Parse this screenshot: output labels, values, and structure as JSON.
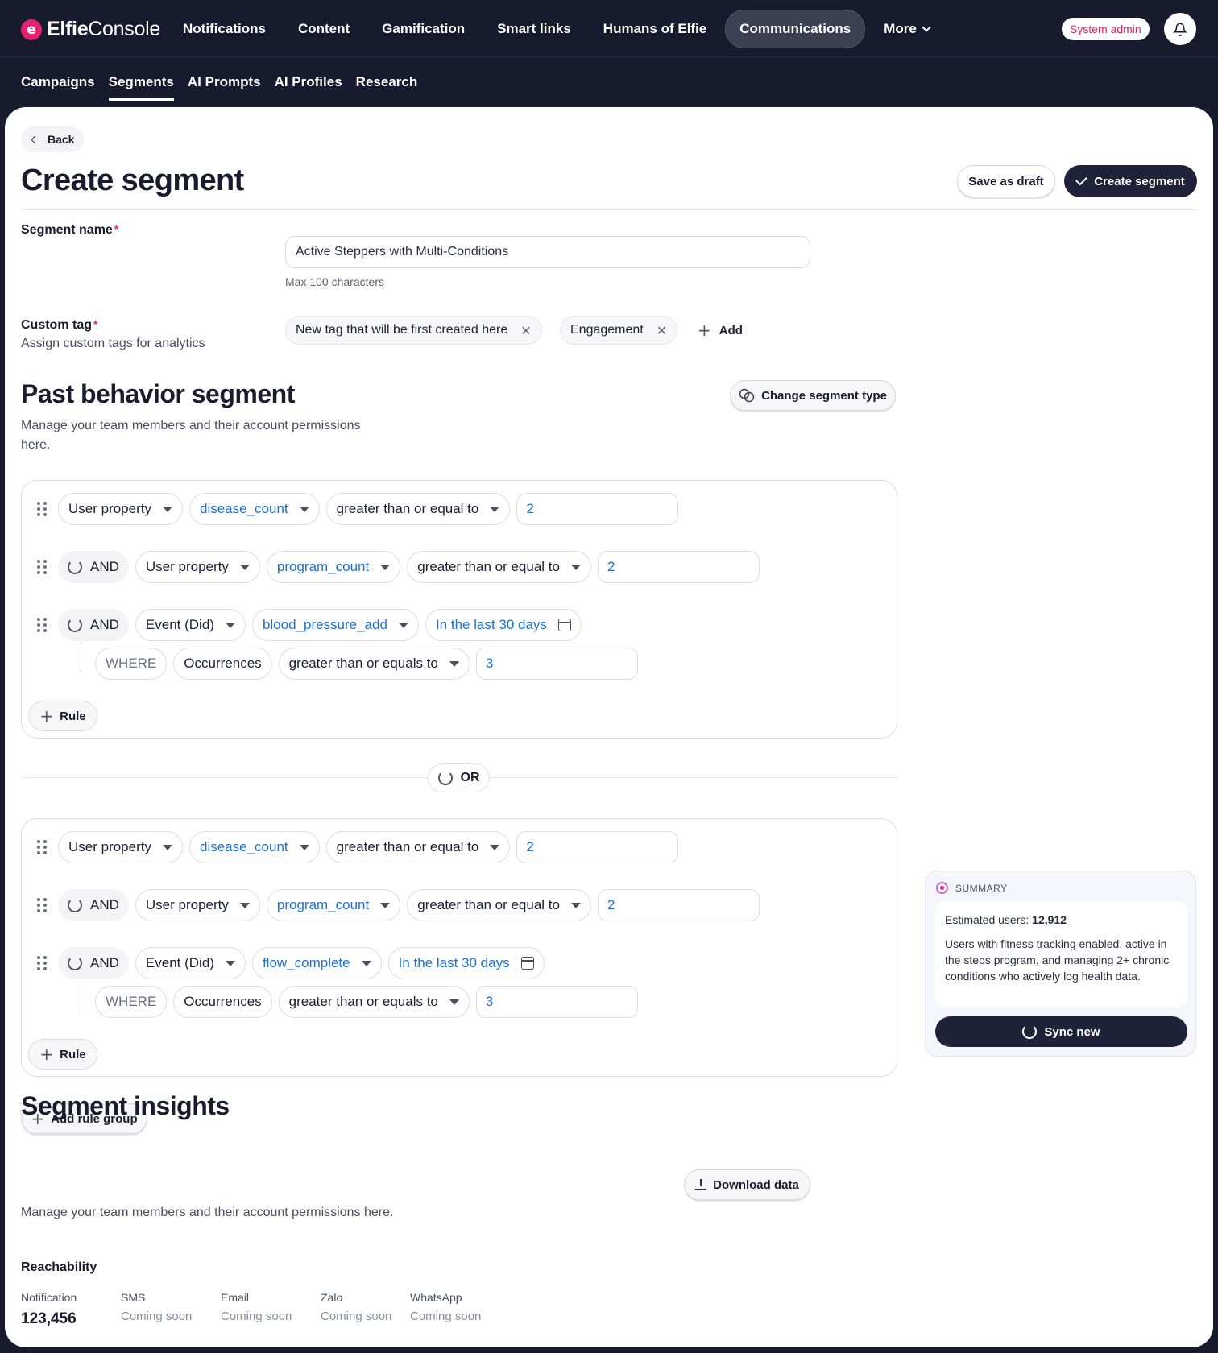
{
  "brand": {
    "name_bold": "Elfie",
    "name_light": "Console",
    "mark": "e",
    "accent": "#e3236f"
  },
  "nav": {
    "items": [
      "Notifications",
      "Content",
      "Gamification",
      "Smart links",
      "Humans of Elfie",
      "Communications"
    ],
    "active": "Communications",
    "more_label": "More"
  },
  "role_badge": "System admin",
  "subnav": {
    "items": [
      "Campaigns",
      "Segments",
      "AI Prompts",
      "AI Profiles",
      "Research"
    ],
    "active": "Segments"
  },
  "back_label": "Back",
  "page_title": "Create segment",
  "actions": {
    "draft": "Save as draft",
    "create": "Create segment"
  },
  "form": {
    "name_label": "Segment name",
    "name_value": "Active Steppers with Multi-Conditions",
    "name_hint": "Max 100 characters",
    "tag_label": "Custom tag",
    "tag_sublabel": "Assign custom tags for analytics",
    "tags": [
      "New tag that will be first created here",
      "Engagement"
    ],
    "add_tag": "Add",
    "required_mark": "*"
  },
  "behavior": {
    "title": "Past behavior segment",
    "description": "Manage your team members and their account permissions here.",
    "change_type": "Change segment type",
    "or_label": "OR",
    "groups": [
      {
        "rule1": {
          "type": "User property",
          "property": "disease_count",
          "operator": "greater than or equal to",
          "value": "2"
        },
        "rule2": {
          "join": "AND",
          "type": "User property",
          "property": "program_count",
          "operator": "greater than or equal to",
          "value": "2"
        },
        "rule3": {
          "join": "AND",
          "type": "Event (Did)",
          "event": "blood_pressure_add",
          "time": "In the last 30 days",
          "where": "WHERE",
          "where_field": "Occurrences",
          "where_operator": "greater than or equals to",
          "where_value": "3"
        },
        "add_rule": "Rule"
      },
      {
        "rule1": {
          "type": "User property",
          "property": "disease_count",
          "operator": "greater than or equal to",
          "value": "2"
        },
        "rule2": {
          "join": "AND",
          "type": "User property",
          "property": "program_count",
          "operator": "greater than or equal to",
          "value": "2"
        },
        "rule3": {
          "join": "AND",
          "type": "Event (Did)",
          "event": "flow_complete",
          "time": "In the last 30 days",
          "where": "WHERE",
          "where_field": "Occurrences",
          "where_operator": "greater than or equals to",
          "where_value": "3"
        },
        "add_rule": "Rule"
      }
    ],
    "add_group": "Add rule group"
  },
  "summary": {
    "heading": "SUMMARY",
    "est_label": "Estimated users:",
    "est_value": "12,912",
    "text": "Users with fitness tracking enabled, active in the steps program, and managing 2+ chronic conditions who actively log health data.",
    "sync": "Sync new"
  },
  "insights": {
    "title": "Segment insights",
    "description": "Manage your team members and their account permissions here.",
    "download": "Download data",
    "reach_label": "Reachability",
    "channels": [
      {
        "name": "Notification",
        "value": "123,456"
      },
      {
        "name": "SMS",
        "status": "Coming soon"
      },
      {
        "name": "Email",
        "status": "Coming soon"
      },
      {
        "name": "Zalo",
        "status": "Coming soon"
      },
      {
        "name": "WhatsApp",
        "status": "Coming soon"
      }
    ]
  }
}
